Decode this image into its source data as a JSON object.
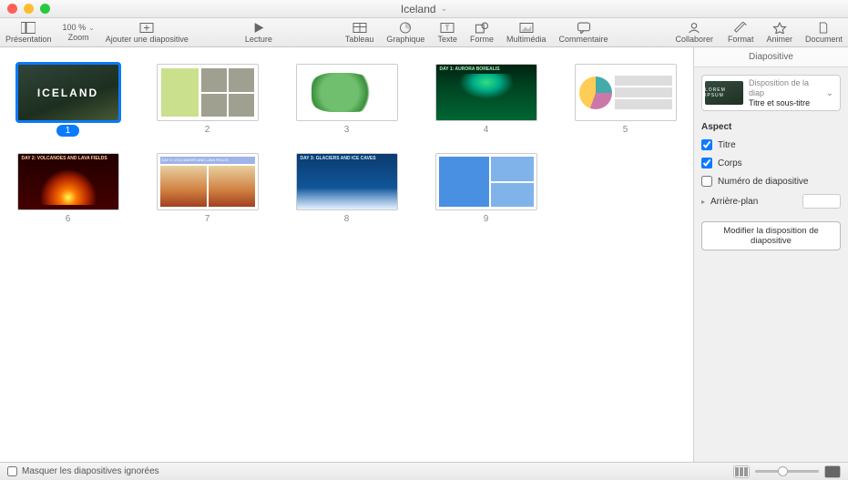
{
  "window": {
    "title": "Iceland"
  },
  "toolbar": {
    "presentation": "Présentation",
    "zoom_label": "Zoom",
    "zoom_value": "100 %",
    "add_slide": "Ajouter une diapositive",
    "play": "Lecture",
    "table": "Tableau",
    "chart": "Graphique",
    "text": "Texte",
    "shape": "Forme",
    "media": "Multimédia",
    "comment": "Commentaire",
    "collaborate": "Collaborer",
    "format": "Format",
    "animate": "Animer",
    "document": "Document"
  },
  "slides": [
    {
      "num": "1",
      "title": "ICELAND",
      "selected": true
    },
    {
      "num": "2",
      "title": "",
      "selected": false
    },
    {
      "num": "3",
      "title": "",
      "selected": false
    },
    {
      "num": "4",
      "title": "DAY 1: AURORA BOREALIS",
      "selected": false
    },
    {
      "num": "5",
      "title": "",
      "selected": false
    },
    {
      "num": "6",
      "title": "DAY 2: VOLCANOES AND LAVA FIELDS",
      "selected": false
    },
    {
      "num": "7",
      "title": "DAY 2: VOLCANOES AND LAVA FIELDS",
      "selected": false
    },
    {
      "num": "8",
      "title": "DAY 3: GLACIERS AND ICE CAVES",
      "selected": false
    },
    {
      "num": "9",
      "title": "",
      "selected": false
    }
  ],
  "inspector": {
    "tab": "Diapositive",
    "layout_caption": "Disposition de la diap",
    "layout_name": "Titre et sous-titre",
    "layout_thumb_text": "LOREM IPSUM",
    "aspect_header": "Aspect",
    "chk_title": "Titre",
    "chk_body": "Corps",
    "chk_slidenum": "Numéro de diapositive",
    "chk_title_checked": true,
    "chk_body_checked": true,
    "chk_slidenum_checked": false,
    "background_label": "Arrière-plan",
    "edit_layout_btn": "Modifier la disposition de diapositive"
  },
  "statusbar": {
    "hide_skipped": "Masquer les diapositives ignorées",
    "hide_skipped_checked": false
  }
}
